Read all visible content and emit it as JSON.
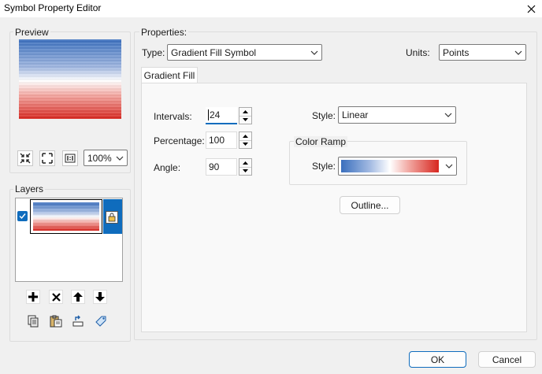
{
  "window": {
    "title": "Symbol Property Editor",
    "close_icon": "close-icon"
  },
  "preview": {
    "label": "Preview",
    "zoom": "100%"
  },
  "layers": {
    "label": "Layers",
    "checked": true
  },
  "properties": {
    "label": "Properties:",
    "type_label": "Type:",
    "type_value": "Gradient Fill Symbol",
    "units_label": "Units:",
    "units_value": "Points",
    "tab": "Gradient Fill",
    "intervals_label": "Intervals:",
    "intervals_value": "24",
    "percentage_label": "Percentage:",
    "percentage_value": "100",
    "angle_label": "Angle:",
    "angle_value": "90",
    "style_label": "Style:",
    "style_value": "Linear",
    "color_ramp_label": "Color Ramp",
    "ramp_style_label": "Style:",
    "outline_label": "Outline..."
  },
  "footer": {
    "ok_label": "OK",
    "cancel_label": "Cancel"
  },
  "colors": {
    "ramp_start": "#3a6fbd",
    "ramp_mid": "#ffffff",
    "ramp_end": "#d7261f",
    "accent": "#0f6cbd"
  }
}
